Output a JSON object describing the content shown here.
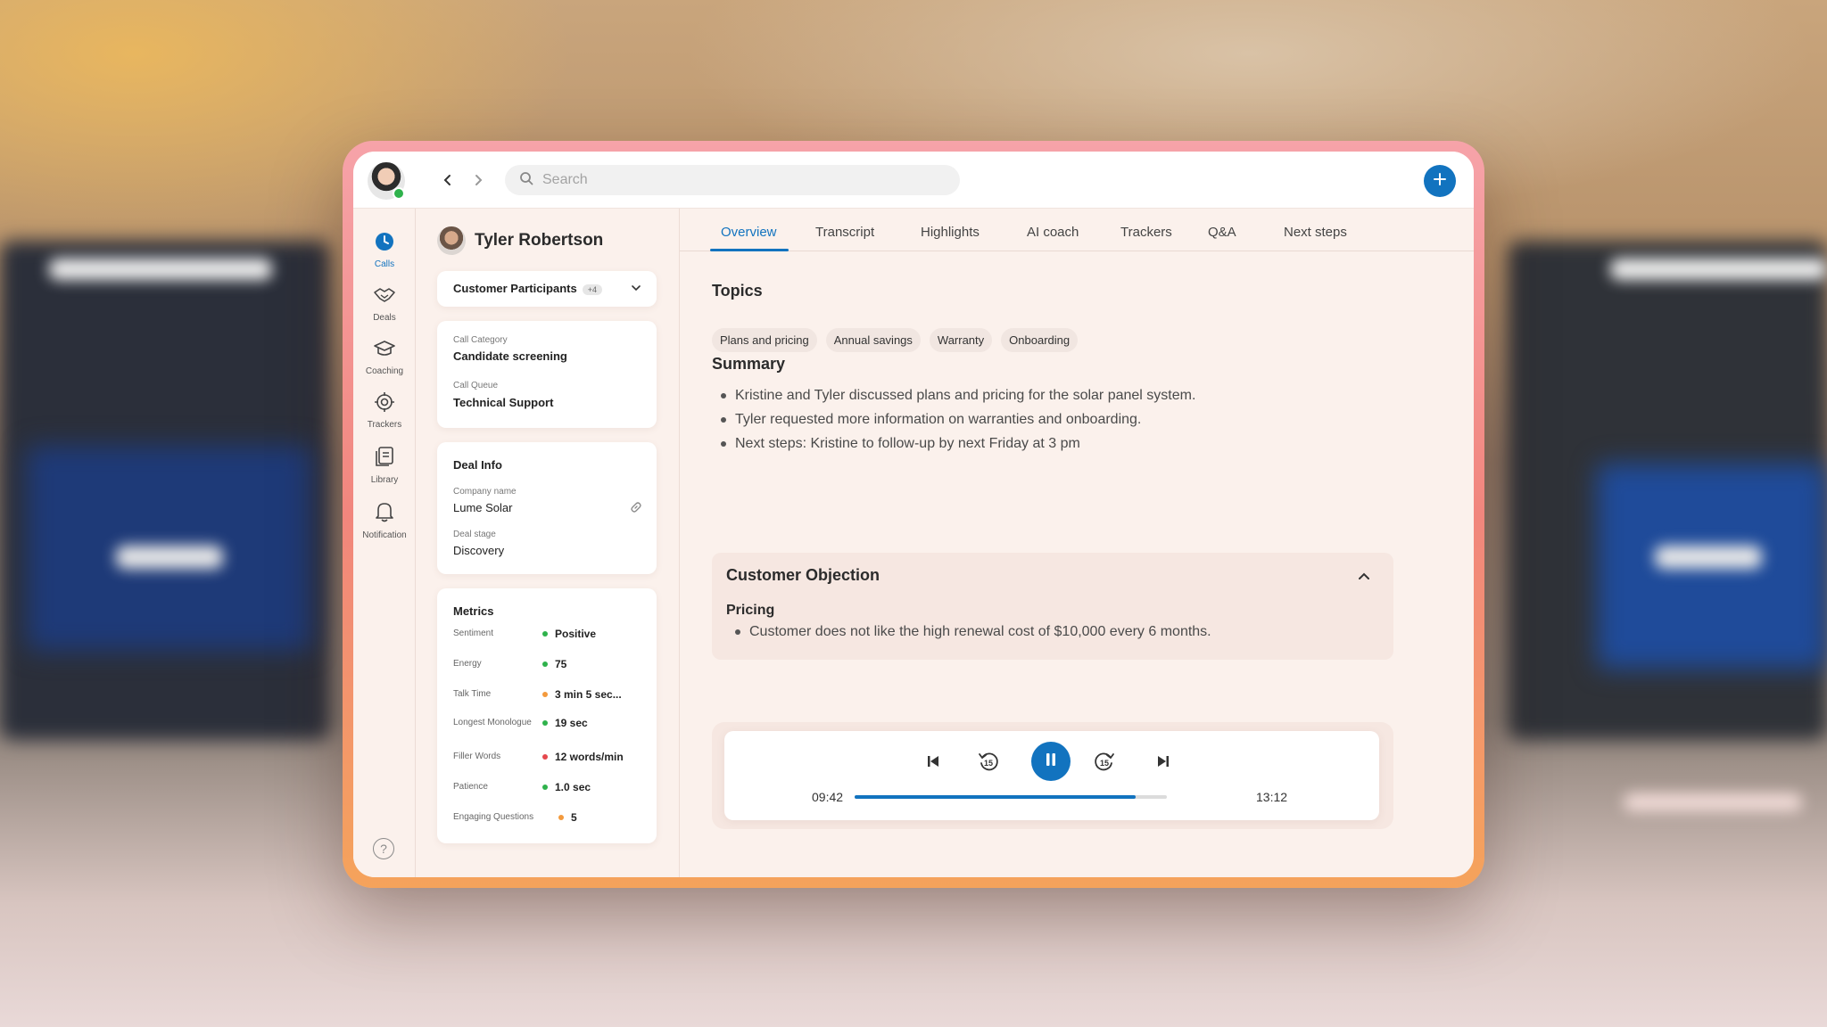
{
  "colors": {
    "accent": "#1273bf",
    "positive": "#2fb24c",
    "warning": "#f39a3d",
    "negative": "#e5484d"
  },
  "search": {
    "placeholder": "Search"
  },
  "rail": {
    "items": [
      {
        "label": "Calls",
        "icon": "clock-icon"
      },
      {
        "label": "Deals",
        "icon": "handshake-icon"
      },
      {
        "label": "Coaching",
        "icon": "graduation-cap-icon"
      },
      {
        "label": "Trackers",
        "icon": "target-icon"
      },
      {
        "label": "Library",
        "icon": "library-icon"
      },
      {
        "label": "Notification",
        "icon": "bell-icon"
      }
    ],
    "help": "?"
  },
  "person": {
    "name": "Tyler Robertson"
  },
  "participants": {
    "label": "Customer Participants",
    "count": "+4"
  },
  "call": {
    "category_label": "Call Category",
    "category_value": "Candidate screening",
    "queue_label": "Call Queue",
    "queue_value": "Technical Support"
  },
  "deal": {
    "title": "Deal Info",
    "company_label": "Company name",
    "company_value": "Lume Solar",
    "stage_label": "Deal stage",
    "stage_value": "Discovery"
  },
  "metrics": {
    "title": "Metrics",
    "rows": [
      {
        "label": "Sentiment",
        "value": "Positive",
        "status": "positive"
      },
      {
        "label": "Energy",
        "value": "75",
        "status": "positive"
      },
      {
        "label": "Talk Time",
        "value": "3 min 5 sec...",
        "status": "warning"
      },
      {
        "label": "Longest Monologue",
        "value": "19 sec",
        "status": "positive"
      },
      {
        "label": "Filler Words",
        "value": "12 words/min",
        "status": "negative"
      },
      {
        "label": "Patience",
        "value": "1.0 sec",
        "status": "positive"
      },
      {
        "label": "Engaging Questions",
        "value": "5",
        "status": "warning"
      }
    ]
  },
  "tabs": [
    "Overview",
    "Transcript",
    "Highlights",
    "AI coach",
    "Trackers",
    "Q&A",
    "Next steps"
  ],
  "active_tab": "Overview",
  "topics": {
    "title": "Topics",
    "chips": [
      "Plans and pricing",
      "Annual savings",
      "Warranty",
      "Onboarding"
    ]
  },
  "summary": {
    "title": "Summary",
    "bullets": [
      "Kristine and Tyler discussed plans and pricing for the solar panel system.",
      "Tyler requested more information on warranties and onboarding.",
      "Next steps: Kristine to follow-up by next Friday at 3 pm"
    ]
  },
  "objection": {
    "title": "Customer Objection",
    "subtitle": "Pricing",
    "bullet": "Customer does not like the high renewal cost of $10,000 every 6 months."
  },
  "player": {
    "current": "09:42",
    "total": "13:12",
    "progress_fraction": 0.9,
    "skip_seconds": "15"
  }
}
